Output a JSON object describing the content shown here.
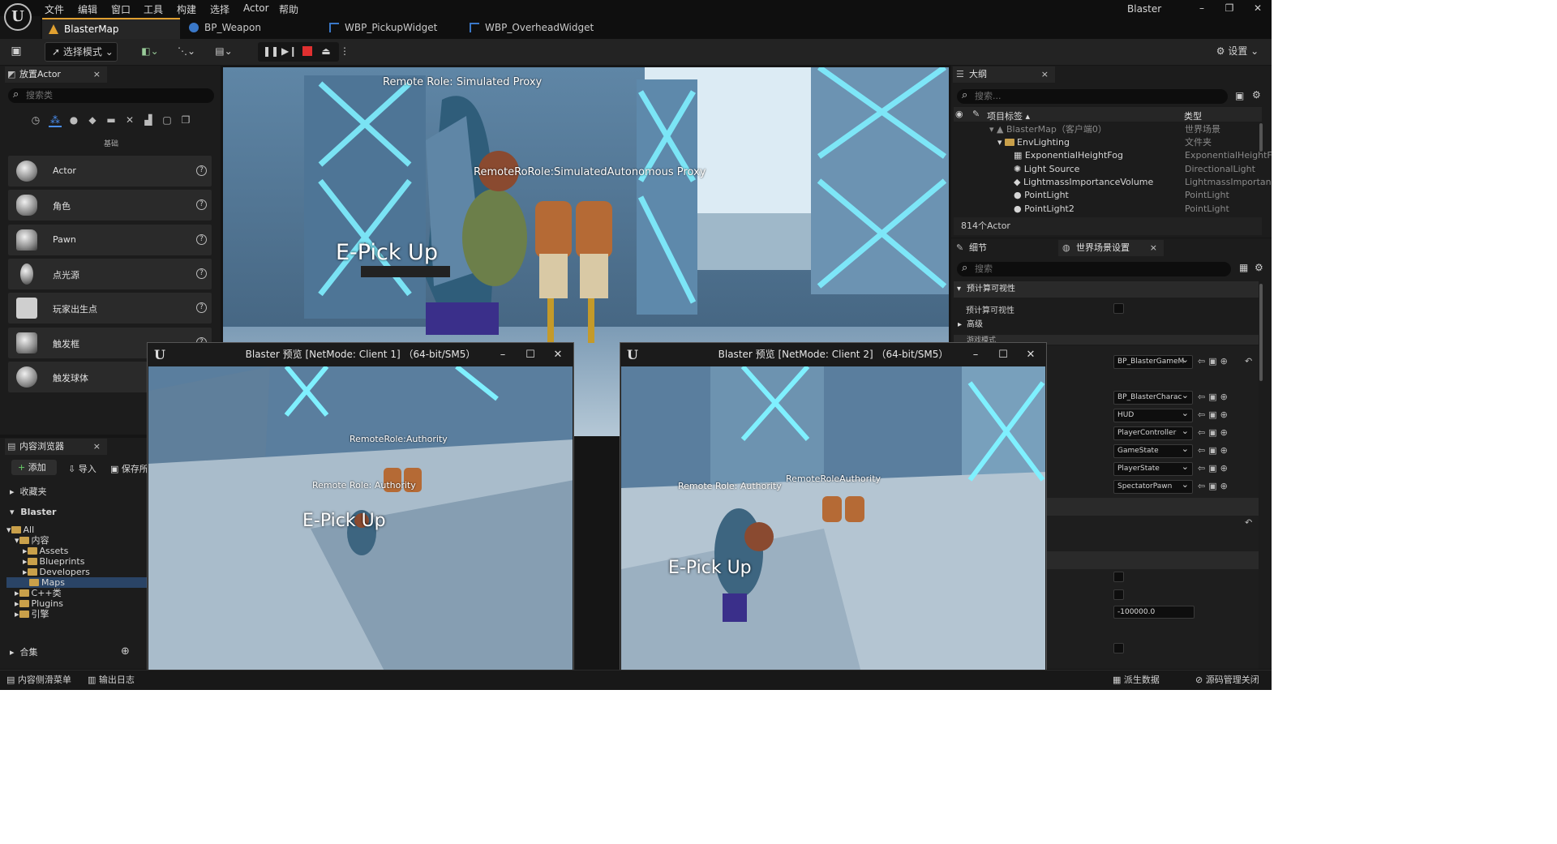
{
  "app": {
    "logo": "U",
    "title": "Blaster"
  },
  "menu": [
    "文件",
    "编辑",
    "窗口",
    "工具",
    "构建",
    "选择",
    "Actor",
    "帮助"
  ],
  "window_controls": [
    "–",
    "❐",
    "✕"
  ],
  "tabs": [
    {
      "label": "BlasterMap",
      "active": true,
      "color": "#e0a030"
    },
    {
      "label": "BP_Weapon",
      "active": false,
      "color": "#3a78c8"
    },
    {
      "label": "WBP_PickupWidget",
      "active": false,
      "color": "#3a78c8"
    },
    {
      "label": "WBP_OverheadWidget",
      "active": false,
      "color": "#3a78c8"
    }
  ],
  "toolbar": {
    "mode_label": "选择模式",
    "settings_label": "设置",
    "stop_color": "#e03030"
  },
  "place_actors": {
    "title": "放置Actor",
    "close": "×",
    "search_placeholder": "搜索类",
    "category_label": "基础",
    "items": [
      {
        "label": "Actor",
        "icon": "sphere-icon"
      },
      {
        "label": "角色",
        "icon": "character-icon"
      },
      {
        "label": "Pawn",
        "icon": "pawn-icon"
      },
      {
        "label": "点光源",
        "icon": "point-light-icon"
      },
      {
        "label": "玩家出生点",
        "icon": "player-start-icon"
      },
      {
        "label": "触发框",
        "icon": "trigger-box-icon"
      },
      {
        "label": "触发球体",
        "icon": "trigger-sphere-icon"
      }
    ],
    "help": "?"
  },
  "content_browser": {
    "title": "内容浏览器",
    "close": "×",
    "add_label": "添加",
    "import_label": "导入",
    "save_label": "保存所",
    "favorites": "收藏夹",
    "project": "Blaster",
    "tree": [
      "All",
      "内容",
      "Assets",
      "Blueprints",
      "Developers",
      "Maps",
      "C++类",
      "Plugins",
      "引擎"
    ],
    "collections": "合集"
  },
  "outliner": {
    "title": "大纲",
    "close": "×",
    "search_placeholder": "搜索...",
    "col_label": "项目标签",
    "col_type": "类型",
    "rows": [
      {
        "label": "BlasterMap（客户端0）",
        "type": "世界场景"
      },
      {
        "label": "EnvLighting",
        "type": "文件夹"
      },
      {
        "label": "ExponentialHeightFog",
        "type": "ExponentialHeightF"
      },
      {
        "label": "Light Source",
        "type": "DirectionalLight"
      },
      {
        "label": "LightmassImportanceVolume",
        "type": "LightmassImportan"
      },
      {
        "label": "PointLight",
        "type": "PointLight"
      },
      {
        "label": "PointLight2",
        "type": "PointLight"
      }
    ],
    "count": "814个Actor"
  },
  "details": {
    "tab_details": "细节",
    "tab_world": "世界场景设置",
    "close": "×",
    "search_placeholder": "搜索",
    "section_precomputed": "预计算可视性",
    "prop_precomputed": "预计算可视性",
    "section_advanced": "高级",
    "section_next": "游戏模式",
    "combos": [
      "BP_BlasterGameM",
      "BP_BlasterCharac",
      "HUD",
      "PlayerController",
      "GameState",
      "PlayerState",
      "SpectatorPawn"
    ],
    "value_field": "-100000.0"
  },
  "viewport": {
    "label_top": "Remote Role: Simulated Proxy",
    "label_overlap": "RemoteRoRole:SimulatedAutonomous Proxy",
    "pickup": "E-Pick Up"
  },
  "pie_windows": [
    {
      "title": "Blaster 预览 [NetMode: Client 1]  （64-bit/SM5）",
      "label_a": "RemoteRole:Authority",
      "label_b": "Remote Role: Authority",
      "pickup": "E-Pick Up"
    },
    {
      "title": "Blaster 预览 [NetMode: Client 2]  （64-bit/SM5）",
      "label_a": "Remote Role: Authority",
      "label_b": "RemoteRoleAuthority",
      "pickup": "E-Pick Up"
    }
  ],
  "statusbar": {
    "drawer": "内容侧滑菜单",
    "output_log": "输出日志",
    "derived_data": "派生数据",
    "source_control": "源码管理关闭"
  }
}
